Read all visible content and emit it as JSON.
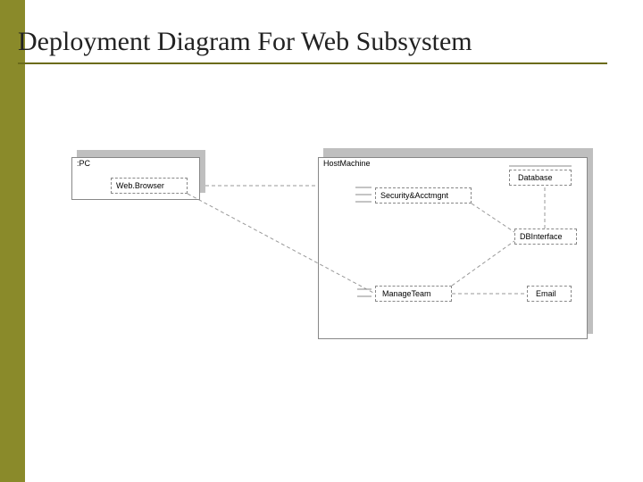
{
  "title": "Deployment Diagram For Web Subsystem",
  "nodes": {
    "pc": {
      "label": ":PC"
    },
    "host": {
      "label": "HostMachine"
    }
  },
  "components": {
    "browser": {
      "label": "Web.Browser"
    },
    "security": {
      "label": "Security&Acctmgnt"
    },
    "database": {
      "label": "Database"
    },
    "dbinterface": {
      "label": "DBInterface"
    },
    "manageteam": {
      "label": "ManageTeam"
    },
    "email": {
      "label": "Email"
    }
  }
}
